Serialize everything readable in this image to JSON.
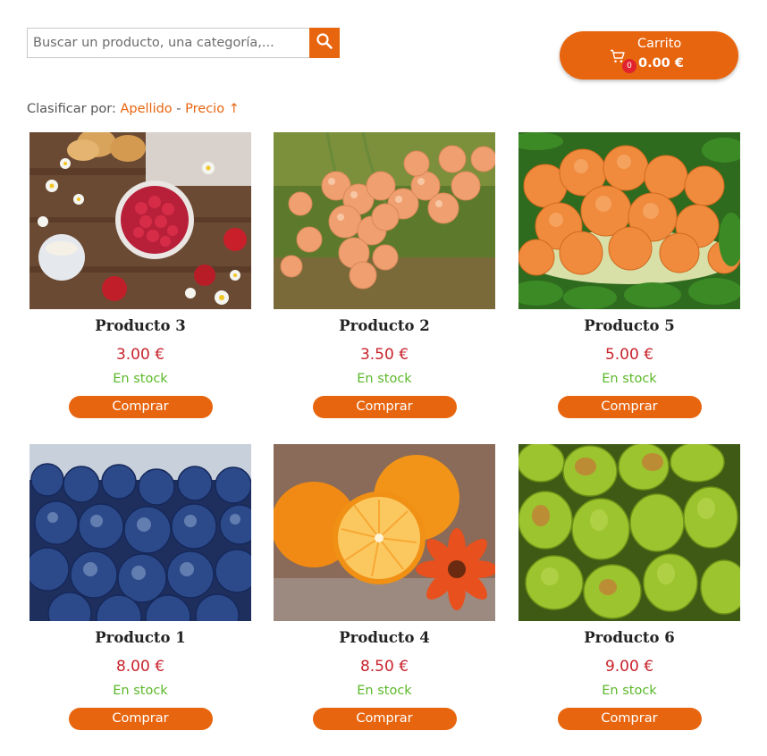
{
  "search": {
    "placeholder": "Buscar un producto, una categoría,...",
    "icon": "search-icon"
  },
  "cart": {
    "title": "Carrito",
    "count": "0",
    "amount": "0.00 €",
    "icon": "cart-icon"
  },
  "sort": {
    "label": "Clasificar por:",
    "option_surname": "Apellido",
    "separator": "-",
    "option_price": "Precio",
    "direction": "↑"
  },
  "colors": {
    "accent": "#e8650f",
    "price": "#c8232c",
    "stock": "#5cb82a",
    "badge": "#e0232c"
  },
  "products": [
    {
      "name": "Producto 3",
      "price": "3.00 €",
      "stock": "En stock",
      "button": "Comprar",
      "image": "raspberries-flowers-cookies"
    },
    {
      "name": "Producto 2",
      "price": "3.50 €",
      "stock": "En stock",
      "button": "Comprar",
      "image": "white-currants"
    },
    {
      "name": "Producto 5",
      "price": "5.00 €",
      "stock": "En stock",
      "button": "Comprar",
      "image": "apricots"
    },
    {
      "name": "Producto 1",
      "price": "8.00 €",
      "stock": "En stock",
      "button": "Comprar",
      "image": "blueberries"
    },
    {
      "name": "Producto 4",
      "price": "8.50 €",
      "stock": "En stock",
      "button": "Comprar",
      "image": "oranges-gerbera"
    },
    {
      "name": "Producto 6",
      "price": "9.00 €",
      "stock": "En stock",
      "button": "Comprar",
      "image": "pears"
    }
  ]
}
